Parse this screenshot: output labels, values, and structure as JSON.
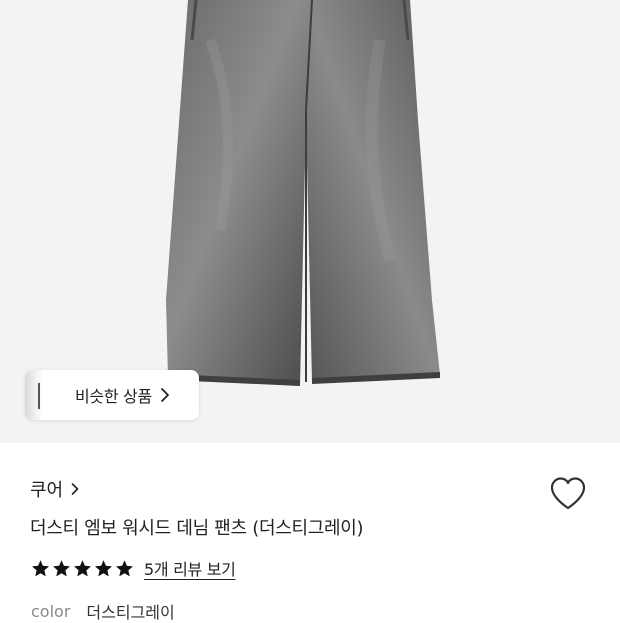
{
  "hero": {
    "image_alt": "dusty grey washed wide denim pants",
    "similar_button": {
      "label": "비슷한 상품",
      "icon": "chevron-right-icon"
    }
  },
  "product": {
    "brand": "쿠어",
    "title": "더스티 엠보 워시드 데님 팬츠 (더스티그레이)",
    "rating": 5,
    "rating_max": 5,
    "review_link": "5개 리뷰 보기",
    "option_label": "color",
    "option_value": "더스티그레이",
    "wishlist_icon": "heart-outline-icon"
  },
  "colors": {
    "star": "#111111",
    "hero_bg": "#f3f3f3",
    "denim": "#555555"
  }
}
